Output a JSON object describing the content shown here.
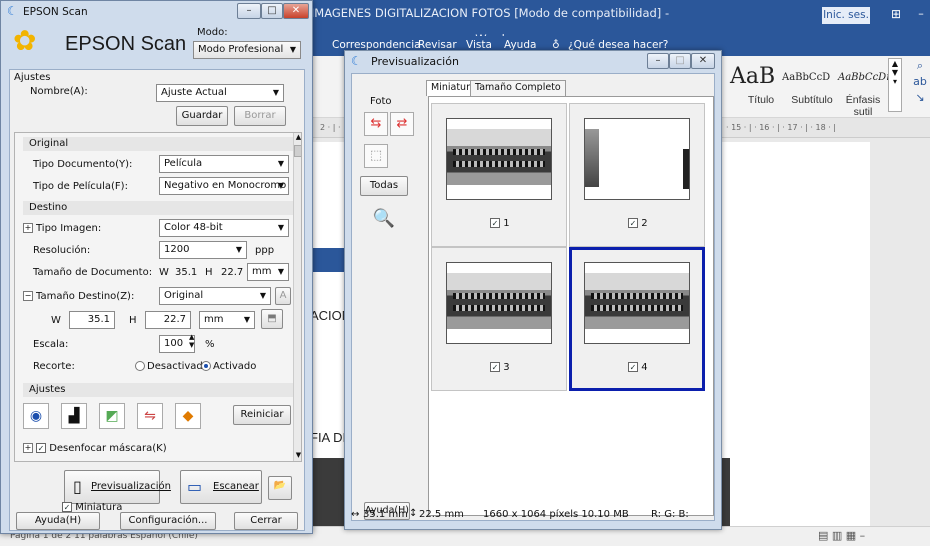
{
  "word": {
    "title": "IMAGENES DIGITALIZACION FOTOS [Modo de compatibilidad] - Word",
    "signin": "Inic. ses.",
    "tabs": [
      "Correspondencia",
      "Revisar",
      "Vista",
      "Ayuda",
      "¿Qué desea hacer?"
    ],
    "styles": [
      {
        "sample": "AaB",
        "name": "Título"
      },
      {
        "sample": "AaBbCcD",
        "name": "Subtítulo"
      },
      {
        "sample": "AaBbCcDı",
        "name": "Énfasis sutil"
      }
    ],
    "ruler_text": "· 15 · | · 16 · | · 17 · | · 18 · |",
    "left_ruler": "2 · | ·",
    "doc_text_1": "ACION I",
    "doc_text_2": "FIA DIG",
    "status_left": "Página 1 de 2    11 palabras    Español (Chile)"
  },
  "epson": {
    "title": "EPSON Scan",
    "logo": "EPSON Scan",
    "mode_label": "Modo:",
    "mode_value": "Modo Profesional",
    "ajustes_title": "Ajustes",
    "nombre_label": "Nombre(A):",
    "nombre_value": "Ajuste Actual",
    "guardar": "Guardar",
    "borrar": "Borrar",
    "original": "Original",
    "tipo_doc_label": "Tipo Documento(Y):",
    "tipo_doc_value": "Película",
    "tipo_pel_label": "Tipo de Película(F):",
    "tipo_pel_value": "Negativo en Monocromo",
    "destino": "Destino",
    "tipo_img_label": "Tipo Imagen:",
    "tipo_img_value": "Color 48-bit",
    "resol_label": "Resolución:",
    "resol_value": "1200",
    "ppp": "ppp",
    "tam_doc_label": "Tamaño de Documento:",
    "w": "W",
    "h": "H",
    "doc_w": "35.1",
    "doc_h": "22.7",
    "unit": "mm",
    "tam_dest_label": "Tamaño Destino(Z):",
    "tam_dest_value": "Original",
    "dest_w": "35.1",
    "dest_h": "22.7",
    "escala_label": "Escala:",
    "escala_value": "100",
    "pct": "%",
    "recorte_label": "Recorte:",
    "desactivado": "Desactivado",
    "activado": "Activado",
    "ajustes_sub": "Ajustes",
    "reiniciar": "Reiniciar",
    "desenfocar": "Desenfocar máscara(K)",
    "previsualizacion": "Previsualización",
    "escanear": "Escanear",
    "miniatura": "Miniatura",
    "ayuda": "Ayuda(H)",
    "configuracion": "Configuración...",
    "cerrar": "Cerrar"
  },
  "preview": {
    "title": "Previsualización",
    "foto": "Foto",
    "todas": "Todas",
    "tab_miniatura": "Miniatura",
    "tab_completo": "Tamaño Completo",
    "thumbs": [
      {
        "label": "1",
        "checked": true
      },
      {
        "label": "2",
        "checked": true
      },
      {
        "label": "3",
        "checked": true
      },
      {
        "label": "4",
        "checked": true
      }
    ],
    "ayuda": "Ayuda(H)",
    "size_w": "35.1 mm",
    "size_h": "22.5 mm",
    "pixels": "1660 x 1064 píxels 10.10 MB",
    "rgb": "R: G: B:"
  }
}
